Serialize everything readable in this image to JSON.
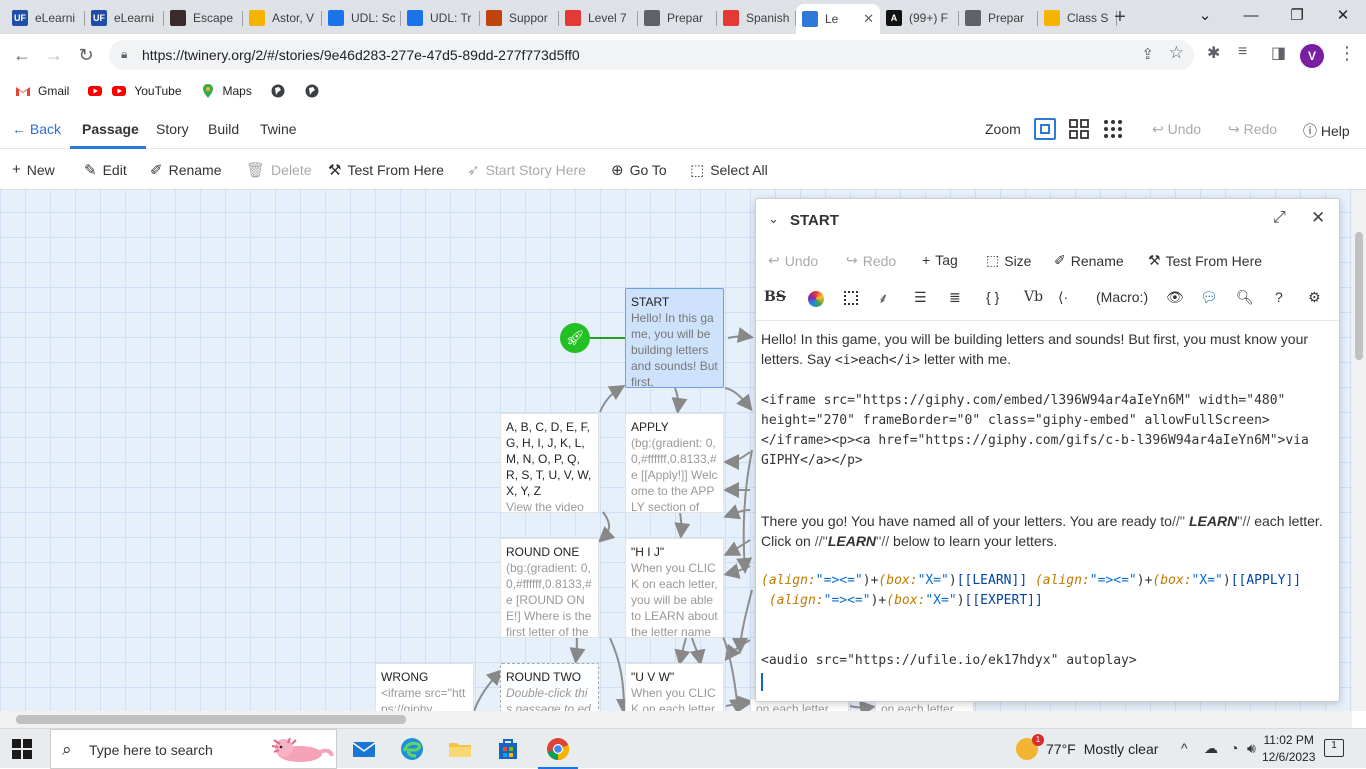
{
  "browser": {
    "tabs": [
      {
        "label": "eLearni",
        "fav_text": "UF",
        "fav_color": "#1f4ea8"
      },
      {
        "label": "eLearni",
        "fav_text": "UF",
        "fav_color": "#1f4ea8"
      },
      {
        "label": "Escape",
        "fav_text": "",
        "fav_color": "#3b2a2a"
      },
      {
        "label": "Astor, V",
        "fav_text": "",
        "fav_color": "#f4b400"
      },
      {
        "label": "UDL: Sc",
        "fav_text": "",
        "fav_color": "#1a73e8"
      },
      {
        "label": "UDL: Tr",
        "fav_text": "",
        "fav_color": "#1a73e8"
      },
      {
        "label": "Suppor",
        "fav_text": "",
        "fav_color": "#c1440e"
      },
      {
        "label": "Level 7",
        "fav_text": "",
        "fav_color": "#e53935"
      },
      {
        "label": "Prepar",
        "fav_text": "",
        "fav_color": "#5f6368"
      },
      {
        "label": "Spanish",
        "fav_text": "",
        "fav_color": "#e53935"
      },
      {
        "label": "Le",
        "fav_text": "",
        "fav_color": "#2d7ad6",
        "active": true
      },
      {
        "label": "(99+) F",
        "fav_text": "A",
        "fav_color": "#111111"
      },
      {
        "label": "Prepar",
        "fav_text": "",
        "fav_color": "#5f6368"
      },
      {
        "label": "Class S",
        "fav_text": "",
        "fav_color": "#f4b400"
      }
    ],
    "new_tab_glyph": "+",
    "url": "https://twinery.org/2/#/stories/9e46d283-277e-47d5-89dd-277f773d5ff0",
    "profile_initial": "V",
    "bookmarks": [
      {
        "label": "Gmail",
        "icon": "gmail-icon"
      },
      {
        "label": "YouTube",
        "icon": "youtube-icon"
      },
      {
        "label": "Maps",
        "icon": "maps-icon"
      },
      {
        "label": "",
        "icon": "globe-icon"
      },
      {
        "label": "",
        "icon": "globe-icon"
      }
    ]
  },
  "twine": {
    "top": {
      "back": "Back",
      "tabs": [
        "Passage",
        "Story",
        "Build",
        "Twine"
      ],
      "zoom_label": "Zoom",
      "undo": "Undo",
      "redo": "Redo",
      "help": "Help"
    },
    "actions": {
      "new": "New",
      "edit": "Edit",
      "rename": "Rename",
      "delete": "Delete",
      "test_from_here": "Test From Here",
      "start_story_here": "Start Story Here",
      "go_to": "Go To",
      "select_all": "Select All"
    },
    "passages": [
      {
        "title": "START",
        "excerpt": "Hello! In this game, you will be building letters and sounds! But first,",
        "style": "selected"
      },
      {
        "title": "A, B, C, D, E, F, G, H, I, J, K, L, M, N, O, P, Q, R, S, T, U, V, W, X, Y, Z",
        "excerpt": "View the video",
        "style": "normal"
      },
      {
        "title": "APPLY",
        "excerpt": "(bg:(gradient: 0, 0,#ffffff,0.8133,#e [[Apply!]] Welcome to the APPLY section of",
        "style": "normal"
      },
      {
        "title": "ROUND ONE",
        "excerpt": "(bg:(gradient: 0, 0,#ffffff,0.8133,#e [ROUND ONE!] Where is the first letter of the",
        "style": "normal"
      },
      {
        "title": "\"H I J\"",
        "excerpt": "When you CLICK on each letter, you will be able to LEARN about the letter name",
        "style": "normal"
      },
      {
        "title": "WRONG",
        "excerpt": "<iframe src=\"https://giphy",
        "style": "normal"
      },
      {
        "title": "ROUND TWO",
        "excerpt": "Double-click this passage to edit",
        "style": "dashed"
      },
      {
        "title": "\"U V W\"",
        "excerpt": "When you CLICK on each letter",
        "style": "normal"
      },
      {
        "title": "",
        "excerpt": "on each letter",
        "style": "normal"
      },
      {
        "title": "",
        "excerpt": "on each letter",
        "style": "normal"
      }
    ],
    "editor": {
      "title": "START",
      "actions": {
        "undo": "Undo",
        "redo": "Redo",
        "tag": "Tag",
        "size": "Size",
        "rename": "Rename",
        "test_from_here": "Test From Here"
      },
      "format_macro_label": "(Macro:)",
      "text": {
        "l1": "Hello! In this game, you will be building letters and sounds! But first, you must know your letters. Say ",
        "l1_tag_open": "<i>",
        "l1_each": "each",
        "l1_tag_close": "</i>",
        "l1_end": " letter with me.",
        "iframe": "<iframe src=\"https://giphy.com/embed/l396W94ar4aIeYn6M\" width=\"480\" height=\"270\" frameBorder=\"0\" class=\"giphy-embed\" allowFullScreen></iframe><p><a href=\"https://giphy.com/gifs/c-b-l396W94ar4aIeYn6M\">via GIPHY</a></p>",
        "p2_a": "There you go! You have named all of your letters. You are ready to",
        "p2_m1": "//''",
        "p2_learn1": "LEARN",
        "p2_m2": "''//",
        "p2_b": " each letter. Click on ",
        "p2_m3": "//''",
        "p2_learn2": "LEARN",
        "p2_m4": "''//",
        "p2_c": " below to learn your letters.",
        "mac_align": "(align:",
        "mac_align_val": "\"=><=\"",
        "mac_close": ")",
        "plus": "+",
        "mac_box": "(box:",
        "mac_box_val": "\"X=\"",
        "link_learn": "[[LEARN]]",
        "link_apply": "[[APPLY]]",
        "link_expert": "[[EXPERT]]",
        "audio": "<audio src=\"https://ufile.io/ek17hdyx\" autoplay>"
      }
    }
  },
  "taskbar": {
    "search_placeholder": "Type here to search",
    "weather_temp": "77°F",
    "weather_text": "Mostly clear",
    "weather_badge": "1",
    "time": "11:02 PM",
    "date": "12/6/2023",
    "notif_count": "1"
  }
}
